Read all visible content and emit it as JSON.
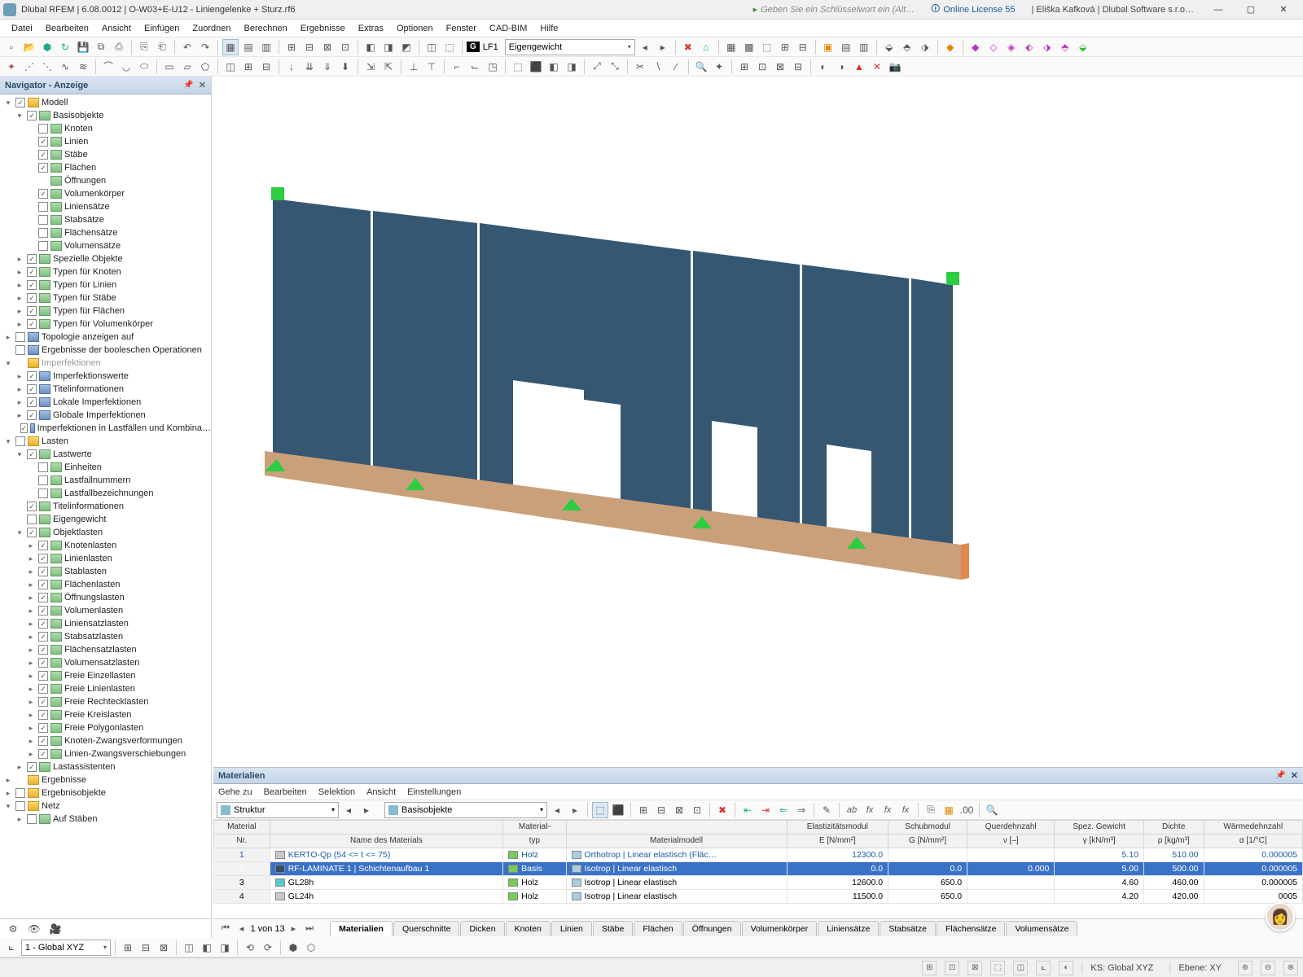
{
  "titlebar": {
    "app": "Dlubal RFEM",
    "version": "6.08.0012",
    "file": "O-W03+E-U12 - Liniengelenke + Sturz.rf6",
    "search_hint": "Geben Sie ein Schlüsselwort ein (Alt…",
    "license": "Online License 55",
    "user": "Eliška Kafková",
    "company": "Dlubal Software s.r.o…"
  },
  "menu": [
    "Datei",
    "Bearbeiten",
    "Ansicht",
    "Einfügen",
    "Zuordnen",
    "Berechnen",
    "Ergebnisse",
    "Extras",
    "Optionen",
    "Fenster",
    "CAD-BIM",
    "Hilfe"
  ],
  "lf_badge": "G",
  "lf_code": "LF1",
  "lf_name": "Eigengewicht",
  "navigator": {
    "title": "Navigator - Anzeige",
    "tree": [
      {
        "d": 0,
        "e": "▾",
        "c": true,
        "i": "folder",
        "t": "Modell"
      },
      {
        "d": 1,
        "e": "▾",
        "c": true,
        "i": "item",
        "t": "Basisobjekte"
      },
      {
        "d": 2,
        "e": "",
        "c": false,
        "i": "item",
        "t": "Knoten"
      },
      {
        "d": 2,
        "e": "",
        "c": true,
        "i": "item",
        "t": "Linien"
      },
      {
        "d": 2,
        "e": "",
        "c": true,
        "i": "item",
        "t": "Stäbe"
      },
      {
        "d": 2,
        "e": "",
        "c": true,
        "i": "item",
        "t": "Flächen"
      },
      {
        "d": 2,
        "e": "",
        "c": null,
        "i": "item",
        "t": "Öffnungen"
      },
      {
        "d": 2,
        "e": "",
        "c": true,
        "i": "item",
        "t": "Volumenkörper"
      },
      {
        "d": 2,
        "e": "",
        "c": false,
        "i": "item",
        "t": "Liniensätze"
      },
      {
        "d": 2,
        "e": "",
        "c": false,
        "i": "item",
        "t": "Stabsätze"
      },
      {
        "d": 2,
        "e": "",
        "c": false,
        "i": "item",
        "t": "Flächensätze"
      },
      {
        "d": 2,
        "e": "",
        "c": false,
        "i": "item",
        "t": "Volumensätze"
      },
      {
        "d": 1,
        "e": "▸",
        "c": true,
        "i": "item",
        "t": "Spezielle Objekte"
      },
      {
        "d": 1,
        "e": "▸",
        "c": true,
        "i": "item",
        "t": "Typen für Knoten"
      },
      {
        "d": 1,
        "e": "▸",
        "c": true,
        "i": "item",
        "t": "Typen für Linien"
      },
      {
        "d": 1,
        "e": "▸",
        "c": true,
        "i": "item",
        "t": "Typen für Stäbe"
      },
      {
        "d": 1,
        "e": "▸",
        "c": true,
        "i": "item",
        "t": "Typen für Flächen"
      },
      {
        "d": 1,
        "e": "▸",
        "c": true,
        "i": "item",
        "t": "Typen für Volumenkörper"
      },
      {
        "d": 0,
        "e": "▸",
        "c": false,
        "i": "blue",
        "t": "Topologie anzeigen auf"
      },
      {
        "d": 0,
        "e": "",
        "c": false,
        "i": "blue",
        "t": "Ergebnisse der booleschen Operationen"
      },
      {
        "d": 0,
        "e": "▾",
        "c": null,
        "i": "folder",
        "t": "Imperfektionen",
        "dim": true
      },
      {
        "d": 1,
        "e": "▸",
        "c": true,
        "i": "blue",
        "t": "Imperfektionswerte"
      },
      {
        "d": 1,
        "e": "▸",
        "c": true,
        "i": "blue",
        "t": "Titelinformationen"
      },
      {
        "d": 1,
        "e": "▸",
        "c": true,
        "i": "blue",
        "t": "Lokale Imperfektionen"
      },
      {
        "d": 1,
        "e": "▸",
        "c": true,
        "i": "blue",
        "t": "Globale Imperfektionen"
      },
      {
        "d": 1,
        "e": "",
        "c": true,
        "i": "blue",
        "t": "Imperfektionen in Lastfällen und Kombina…"
      },
      {
        "d": 0,
        "e": "▾",
        "c": false,
        "i": "folder",
        "t": "Lasten"
      },
      {
        "d": 1,
        "e": "▾",
        "c": true,
        "i": "item",
        "t": "Lastwerte"
      },
      {
        "d": 2,
        "e": "",
        "c": false,
        "i": "item",
        "t": "Einheiten"
      },
      {
        "d": 2,
        "e": "",
        "c": false,
        "i": "item",
        "t": "Lastfallnummern"
      },
      {
        "d": 2,
        "e": "",
        "c": false,
        "i": "item",
        "t": "Lastfallbezeichnungen"
      },
      {
        "d": 1,
        "e": "",
        "c": true,
        "i": "item",
        "t": "Titelinformationen"
      },
      {
        "d": 1,
        "e": "",
        "c": false,
        "i": "item",
        "t": "Eigengewicht"
      },
      {
        "d": 1,
        "e": "▾",
        "c": true,
        "i": "item",
        "t": "Objektlasten"
      },
      {
        "d": 2,
        "e": "▸",
        "c": true,
        "i": "item",
        "t": "Knotenlasten"
      },
      {
        "d": 2,
        "e": "▸",
        "c": true,
        "i": "item",
        "t": "Linienlasten"
      },
      {
        "d": 2,
        "e": "▸",
        "c": true,
        "i": "item",
        "t": "Stablasten"
      },
      {
        "d": 2,
        "e": "▸",
        "c": true,
        "i": "item",
        "t": "Flächenlasten"
      },
      {
        "d": 2,
        "e": "▸",
        "c": true,
        "i": "item",
        "t": "Öffnungslasten"
      },
      {
        "d": 2,
        "e": "▸",
        "c": true,
        "i": "item",
        "t": "Volumenlasten"
      },
      {
        "d": 2,
        "e": "▸",
        "c": true,
        "i": "item",
        "t": "Liniensatzlasten"
      },
      {
        "d": 2,
        "e": "▸",
        "c": true,
        "i": "item",
        "t": "Stabsatzlasten"
      },
      {
        "d": 2,
        "e": "▸",
        "c": true,
        "i": "item",
        "t": "Flächensatzlasten"
      },
      {
        "d": 2,
        "e": "▸",
        "c": true,
        "i": "item",
        "t": "Volumensatzlasten"
      },
      {
        "d": 2,
        "e": "▸",
        "c": true,
        "i": "item",
        "t": "Freie Einzellasten"
      },
      {
        "d": 2,
        "e": "▸",
        "c": true,
        "i": "item",
        "t": "Freie Linienlasten"
      },
      {
        "d": 2,
        "e": "▸",
        "c": true,
        "i": "item",
        "t": "Freie Rechtecklasten"
      },
      {
        "d": 2,
        "e": "▸",
        "c": true,
        "i": "item",
        "t": "Freie Kreislasten"
      },
      {
        "d": 2,
        "e": "▸",
        "c": true,
        "i": "item",
        "t": "Freie Polygonlasten"
      },
      {
        "d": 2,
        "e": "▸",
        "c": true,
        "i": "item",
        "t": "Knoten-Zwangsverformungen"
      },
      {
        "d": 2,
        "e": "▸",
        "c": true,
        "i": "item",
        "t": "Linien-Zwangsverschiebungen"
      },
      {
        "d": 1,
        "e": "▸",
        "c": true,
        "i": "item",
        "t": "Lastassistenten"
      },
      {
        "d": 0,
        "e": "▸",
        "c": null,
        "i": "folder",
        "t": "Ergebnisse"
      },
      {
        "d": 0,
        "e": "▸",
        "c": false,
        "i": "folder",
        "t": "Ergebnisobjekte"
      },
      {
        "d": 0,
        "e": "▾",
        "c": false,
        "i": "folder",
        "t": "Netz"
      },
      {
        "d": 1,
        "e": "▸",
        "c": false,
        "i": "item",
        "t": "Auf Stäben"
      }
    ]
  },
  "data_panel": {
    "title": "Materialien",
    "menu": [
      "Gehe zu",
      "Bearbeiten",
      "Selektion",
      "Ansicht",
      "Einstellungen"
    ],
    "drop1": "Struktur",
    "drop2": "Basisobjekte",
    "columns": [
      {
        "h1": "Material",
        "h2": "Nr."
      },
      {
        "h1": "",
        "h2": "Name des Materials"
      },
      {
        "h1": "Material-",
        "h2": "typ"
      },
      {
        "h1": "",
        "h2": "Materialmodell"
      },
      {
        "h1": "Elastizitätsmodul",
        "h2": "E [N/mm²]"
      },
      {
        "h1": "Schubmodul",
        "h2": "G [N/mm²]"
      },
      {
        "h1": "Querdehnzahl",
        "h2": "ν [–]"
      },
      {
        "h1": "Spez. Gewicht",
        "h2": "γ [kN/m³]"
      },
      {
        "h1": "Dichte",
        "h2": "ρ [kg/m³]"
      },
      {
        "h1": "Wärmedehnzahl",
        "h2": "α [1/°C]"
      }
    ],
    "rows": [
      {
        "nr": "1",
        "sw": "#c8c8c8",
        "name": "KERTO-Qp (54 <= t <= 75)",
        "typ": "Holz",
        "model": "Orthotrop | Linear elastisch (Fläc…",
        "E": "12300.0",
        "G": "",
        "nu": "",
        "gamma": "5.10",
        "rho": "510.00",
        "alpha": "0.000005",
        "style": "blue"
      },
      {
        "nr": "2",
        "sw": "#304e6a",
        "name": "RF-LAMINATE 1 | Schichtenaufbau 1",
        "typ": "Basis",
        "model": "Isotrop | Linear elastisch",
        "E": "0.0",
        "G": "0.0",
        "nu": "0.000",
        "gamma": "5.00",
        "rho": "500.00",
        "alpha": "0.000005",
        "style": "sel"
      },
      {
        "nr": "3",
        "sw": "#58c8c8",
        "name": "GL28h",
        "typ": "Holz",
        "model": "Isotrop | Linear elastisch",
        "E": "12600.0",
        "G": "650.0",
        "nu": "",
        "gamma": "4.60",
        "rho": "460.00",
        "alpha": "0.000005",
        "style": ""
      },
      {
        "nr": "4",
        "sw": "#c8c8c8",
        "name": "GL24h",
        "typ": "Holz",
        "model": "Isotrop | Linear elastisch",
        "E": "11500.0",
        "G": "650.0",
        "nu": "",
        "gamma": "4.20",
        "rho": "420.00",
        "alpha": "    0005",
        "style": ""
      }
    ],
    "pager_text": "1 von 13",
    "tabs": [
      "Materialien",
      "Querschnitte",
      "Dicken",
      "Knoten",
      "Linien",
      "Stäbe",
      "Flächen",
      "Öffnungen",
      "Volumenkörper",
      "Liniensätze",
      "Stabsätze",
      "Flächensätze",
      "Volumensätze"
    ],
    "active_tab": 0
  },
  "status": {
    "coord_drop": "1 - Global XYZ",
    "ks": "KS: Global XYZ",
    "ebene": "Ebene: XY"
  }
}
